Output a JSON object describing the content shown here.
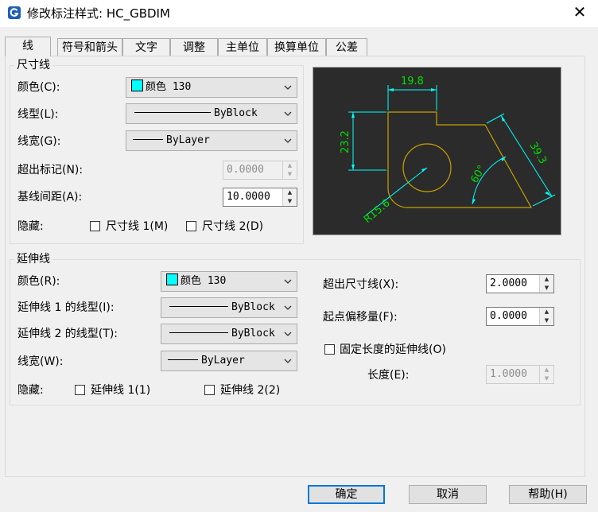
{
  "window": {
    "title": "修改标注样式: HC_GBDIM",
    "close_glyph": "✕",
    "app_icon": "gstarcad-logo-icon"
  },
  "tabs": [
    "线",
    "符号和箭头",
    "文字",
    "调整",
    "主单位",
    "换算单位",
    "公差"
  ],
  "dim_line": {
    "group_title": "尺寸线",
    "color_label": "颜色(C):",
    "color_value": "颜色 130",
    "color_swatch": "#00ffff",
    "linetype_label": "线型(L):",
    "linetype_value": "ByBlock",
    "lineweight_label": "线宽(G):",
    "lineweight_value": "ByLayer",
    "extend_label": "超出标记(N):",
    "extend_value": "0.0000",
    "baseline_label": "基线间距(A):",
    "baseline_value": "10.0000",
    "suppress_label": "隐藏:",
    "suppress1_label": "尺寸线 1(M)",
    "suppress2_label": "尺寸线 2(D)"
  },
  "ext_line": {
    "group_title": "延伸线",
    "color_label": "颜色(R):",
    "color_value": "颜色 130",
    "color_swatch": "#00ffff",
    "linetype1_label": "延伸线 1 的线型(I):",
    "linetype1_value": "ByBlock",
    "linetype2_label": "延伸线 2 的线型(T):",
    "linetype2_value": "ByBlock",
    "lineweight_label": "线宽(W):",
    "lineweight_value": "ByLayer",
    "suppress_label": "隐藏:",
    "suppress1_label": "延伸线 1(1)",
    "suppress2_label": "延伸线 2(2)",
    "beyond_label": "超出尺寸线(X):",
    "beyond_value": "2.0000",
    "offset_label": "起点偏移量(F):",
    "offset_value": "0.0000",
    "fixed_label": "固定长度的延伸线(O)",
    "length_label": "长度(E):",
    "length_value": "1.0000"
  },
  "preview": {
    "dim_top": "19.8",
    "dim_left": "23.2",
    "dim_right": "39.3",
    "dim_angle": "60°",
    "dim_radius": "R15.6",
    "dim_color": "#00ffff",
    "text_color": "#00e000",
    "geom_color": "#c8a000",
    "bg_color": "#2b2b2b"
  },
  "buttons": {
    "ok": "确定",
    "cancel": "取消",
    "help": "帮助(H)"
  }
}
